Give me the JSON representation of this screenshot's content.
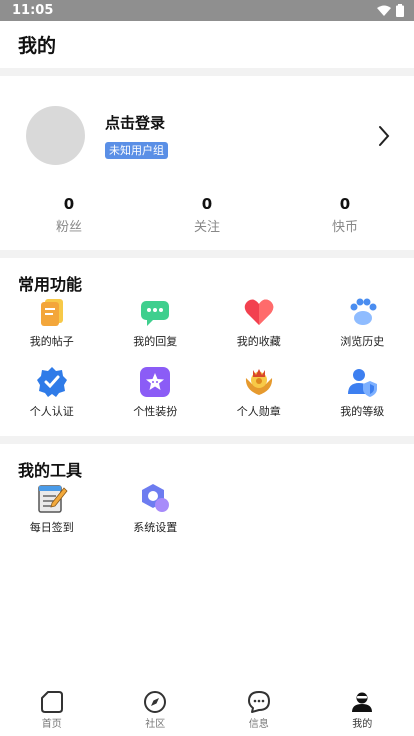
{
  "status_bar": {
    "time": "11:05"
  },
  "header": {
    "title": "我的"
  },
  "profile": {
    "login_text": "点击登录",
    "group_badge": "未知用户组"
  },
  "stats": [
    {
      "value": "0",
      "label": "粉丝"
    },
    {
      "value": "0",
      "label": "关注"
    },
    {
      "value": "0",
      "label": "快币"
    }
  ],
  "common_functions": {
    "title": "常用功能",
    "items": [
      {
        "label": "我的帖子",
        "icon": "posts-icon"
      },
      {
        "label": "我的回复",
        "icon": "reply-icon"
      },
      {
        "label": "我的收藏",
        "icon": "heart-icon"
      },
      {
        "label": "浏览历史",
        "icon": "paw-icon"
      },
      {
        "label": "个人认证",
        "icon": "verified-badge-icon"
      },
      {
        "label": "个性装扮",
        "icon": "star-dress-icon"
      },
      {
        "label": "个人勋章",
        "icon": "medal-icon"
      },
      {
        "label": "我的等级",
        "icon": "user-shield-icon"
      }
    ]
  },
  "tools": {
    "title": "我的工具",
    "items": [
      {
        "label": "每日签到",
        "icon": "notepad-pencil-icon"
      },
      {
        "label": "系统设置",
        "icon": "settings-icon"
      }
    ]
  },
  "tab_bar": [
    {
      "label": "首页",
      "icon": "home-icon"
    },
    {
      "label": "社区",
      "icon": "compass-icon"
    },
    {
      "label": "信息",
      "icon": "message-icon"
    },
    {
      "label": "我的",
      "icon": "profile-icon"
    }
  ],
  "colors": {
    "badge": "#5a8fe6",
    "status_bar": "#8f8f8f",
    "divider": "#f2f2f2"
  }
}
